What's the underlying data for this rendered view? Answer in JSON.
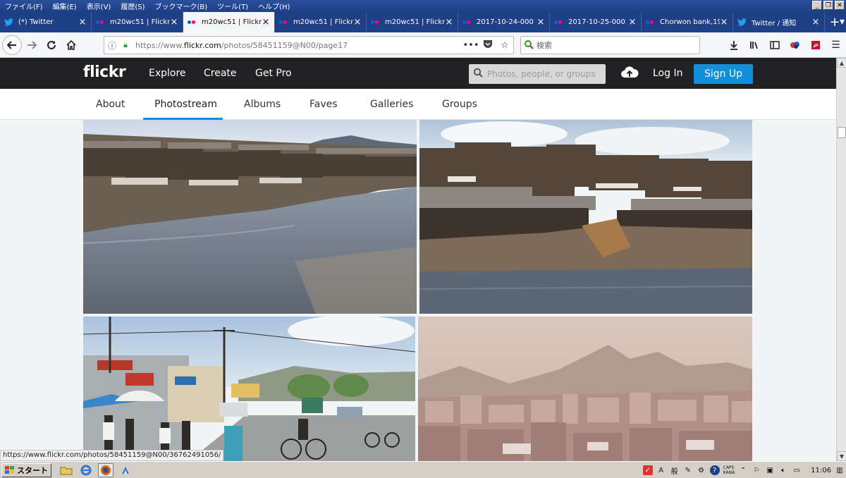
{
  "window": {
    "menu": [
      "ファイル(F)",
      "編集(E)",
      "表示(V)",
      "履歴(S)",
      "ブックマーク(B)",
      "ツール(T)",
      "ヘルプ(H)"
    ],
    "controls": [
      "_",
      "❐",
      "✕"
    ]
  },
  "tabs": [
    {
      "label": "(*) Twitter",
      "favicon": "twitter-icon",
      "active": false
    },
    {
      "label": "m20wc51 | Flickr",
      "favicon": "flickr-icon",
      "active": false
    },
    {
      "label": "m20wc51 | Flickr",
      "favicon": "flickr-icon",
      "active": true
    },
    {
      "label": "m20wc51 | Flickr",
      "favicon": "flickr-icon",
      "active": false
    },
    {
      "label": "m20wc51 | Flickr",
      "favicon": "flickr-icon",
      "active": false
    },
    {
      "label": "2017-10-24-000",
      "favicon": "flickr-icon",
      "active": false
    },
    {
      "label": "2017-10-25-000",
      "favicon": "flickr-icon",
      "active": false
    },
    {
      "label": "Chorwon bank,19",
      "favicon": "flickr-icon",
      "active": false
    },
    {
      "label": "Twitter / 通知",
      "favicon": "twitter-icon",
      "active": false
    }
  ],
  "navbar": {
    "url_prefix": "https://www.",
    "url_domain": "flickr.com",
    "url_path": "/photos/58451159@N00/page17",
    "search_placeholder": "検索"
  },
  "flickr": {
    "logo": "flickr",
    "nav": [
      "Explore",
      "Create",
      "Get Pro"
    ],
    "search_placeholder": "Photos, people, or groups",
    "login": "Log In",
    "signup": "Sign Up"
  },
  "subnav": {
    "items": [
      "About",
      "Photostream",
      "Albums",
      "Faves",
      "Galleries",
      "Groups"
    ],
    "active": "Photostream"
  },
  "photos": [
    {
      "name": "river-shanty-town-photo"
    },
    {
      "name": "riverside-shacks-photo"
    },
    {
      "name": "street-market-photo"
    },
    {
      "name": "hazy-city-skyline-photo"
    }
  ],
  "status_url": "https://www.flickr.com/photos/58451159@N00/36762491056/",
  "taskbar": {
    "start": "スタート",
    "clock": "11:06",
    "caps": "CAPS",
    "kana": "KANA"
  },
  "colors": {
    "flickr_blue": "#128fdc",
    "flickr_pink": "#ff0084",
    "header_bg": "#212124"
  }
}
